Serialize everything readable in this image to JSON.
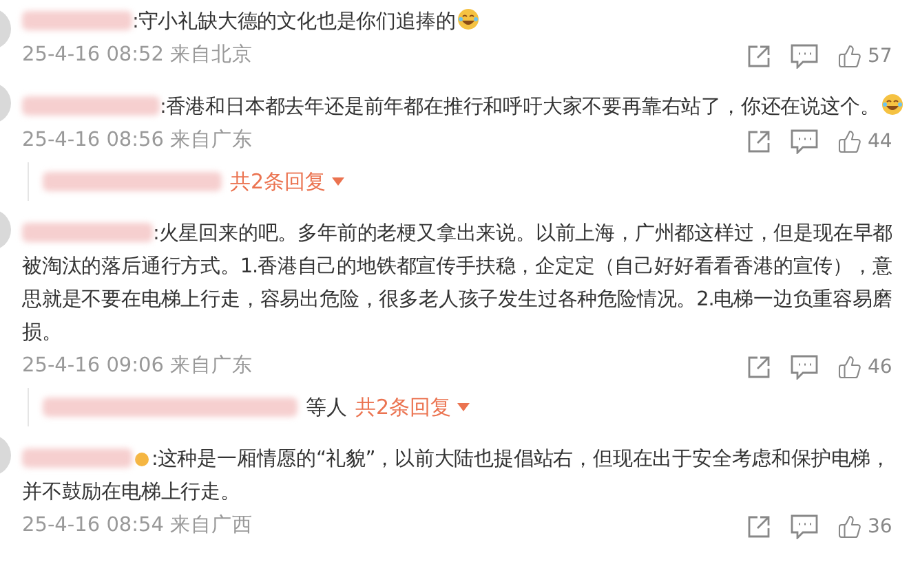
{
  "comments": [
    {
      "text": ":守小礼缺大德的文化也是你们追捧的",
      "emoji": true,
      "badge": false,
      "time": "25-4-16 08:52",
      "location": "来自北京",
      "likes": "57"
    },
    {
      "text": ":香港和日本都去年还是前年都在推行和呼吁大家不要再靠右站了，你还在说这个。",
      "emoji": true,
      "badge": false,
      "time": "25-4-16 08:56",
      "location": "来自广东",
      "likes": "44",
      "replies": {
        "link": "共2条回复"
      }
    },
    {
      "text": ":火星回来的吧。多年前的老梗又拿出来说。以前上海，广州都这样过，但是现在早都被淘汰的落后通行方式。1.香港自己的地铁都宣传手扶稳，企定定（自己好好看看香港的宣传），意思就是不要在电梯上行走，容易出危险，很多老人孩子发生过各种危险情况。2.电梯一边负重容易磨损。",
      "emoji": false,
      "badge": false,
      "time": "25-4-16 09:06",
      "location": "来自广东",
      "likes": "46",
      "replies": {
        "suffix": "等人",
        "link": "共2条回复"
      }
    },
    {
      "text": ":这种是一厢情愿的“礼貌”，以前大陆也提倡站右，但现在出于安全考虑和保护电梯，并不鼓励在电梯上行走。",
      "emoji": false,
      "badge": true,
      "time": "25-4-16 08:54",
      "location": "来自广西",
      "likes": "36"
    }
  ]
}
